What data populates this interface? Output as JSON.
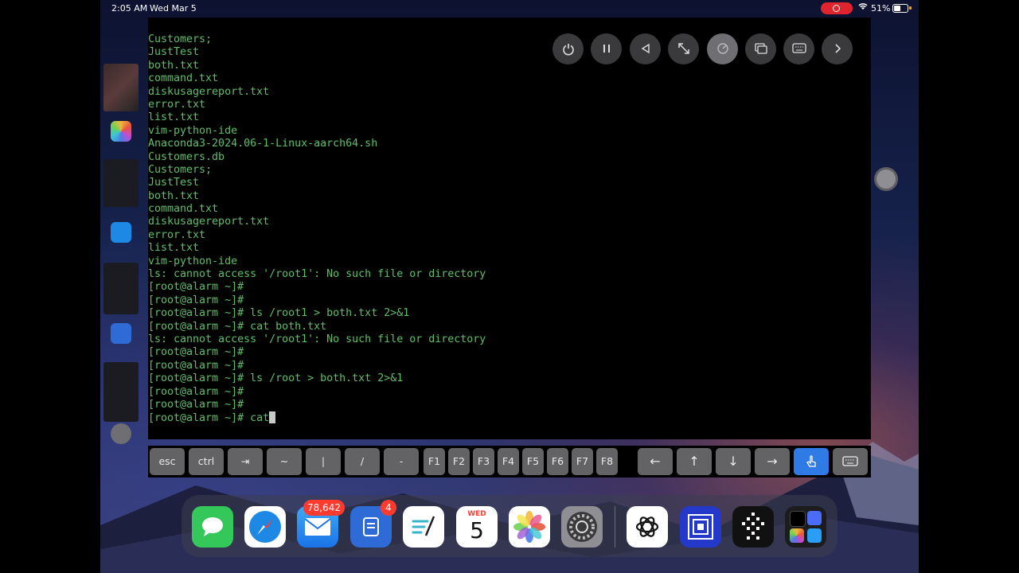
{
  "status": {
    "time": "2:05 AM",
    "date": "Wed Mar 5",
    "battery": "51%"
  },
  "terminal": {
    "lines": [
      "Customers;",
      "JustTest",
      "both.txt",
      "command.txt",
      "diskusagereport.txt",
      "error.txt",
      "list.txt",
      "vim-python-ide",
      "Anaconda3-2024.06-1-Linux-aarch64.sh",
      "Customers.db",
      "Customers;",
      "JustTest",
      "both.txt",
      "command.txt",
      "diskusagereport.txt",
      "error.txt",
      "list.txt",
      "vim-python-ide",
      "ls: cannot access '/root1': No such file or directory",
      "[root@alarm ~]#",
      "[root@alarm ~]#",
      "[root@alarm ~]# ls /root1 > both.txt 2>&1",
      "[root@alarm ~]# cat both.txt",
      "ls: cannot access '/root1': No such file or directory",
      "[root@alarm ~]#",
      "[root@alarm ~]#",
      "[root@alarm ~]# ls /root > both.txt 2>&1",
      "[root@alarm ~]#",
      "[root@alarm ~]#"
    ],
    "current_prompt": "[root@alarm ~]# cat"
  },
  "toolbar": {
    "power_icon": "power-icon",
    "pause_icon": "pause-icon",
    "back_icon": "back-icon",
    "resize_icon": "resize-icon",
    "gauge_icon": "gauge-icon",
    "windows_icon": "windows-icon",
    "keyboard_icon": "keyboard-icon",
    "forward_icon": "forward-icon"
  },
  "keybar": {
    "esc": "esc",
    "ctrl": "ctrl",
    "tab": "⇥",
    "tilde": "~",
    "pipe": "|",
    "slash": "/",
    "dash": "-",
    "f1": "F1",
    "f2": "F2",
    "f3": "F3",
    "f4": "F4",
    "f5": "F5",
    "f6": "F6",
    "f7": "F7",
    "f8": "F8",
    "left": "←",
    "up": "↑",
    "down": "↓",
    "right": "→"
  },
  "dock": {
    "mail_badge": "78,642",
    "notes_badge": "4",
    "calendar_day": "WED",
    "calendar_date": "5"
  },
  "colors": {
    "terminal_text": "#5fbf6a",
    "accent": "#2f7ae5",
    "badge": "#ff3b30"
  }
}
